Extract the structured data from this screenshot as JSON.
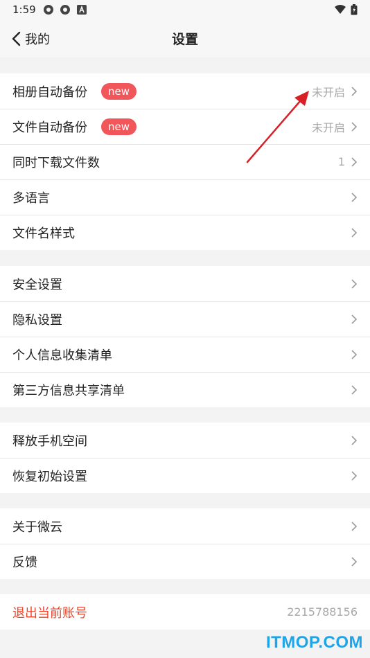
{
  "status": {
    "time": "1:59"
  },
  "nav": {
    "back_label": "我的",
    "title": "设置"
  },
  "groups": [
    [
      {
        "label": "相册自动备份",
        "badge": "new",
        "value": "未开启"
      },
      {
        "label": "文件自动备份",
        "badge": "new",
        "value": "未开启"
      },
      {
        "label": "同时下载文件数",
        "value": "1"
      },
      {
        "label": "多语言"
      },
      {
        "label": "文件名样式"
      }
    ],
    [
      {
        "label": "安全设置"
      },
      {
        "label": "隐私设置"
      },
      {
        "label": "个人信息收集清单"
      },
      {
        "label": "第三方信息共享清单"
      }
    ],
    [
      {
        "label": "释放手机空间"
      },
      {
        "label": "恢复初始设置"
      }
    ],
    [
      {
        "label": "关于微云"
      },
      {
        "label": "反馈"
      }
    ]
  ],
  "logout": {
    "label": "退出当前账号",
    "account": "2215788156"
  },
  "watermark": "ITMOP.COM",
  "colors": {
    "accent": "#e8452c",
    "badge": "#f0565a",
    "annotation_arrow": "#d81f26"
  }
}
